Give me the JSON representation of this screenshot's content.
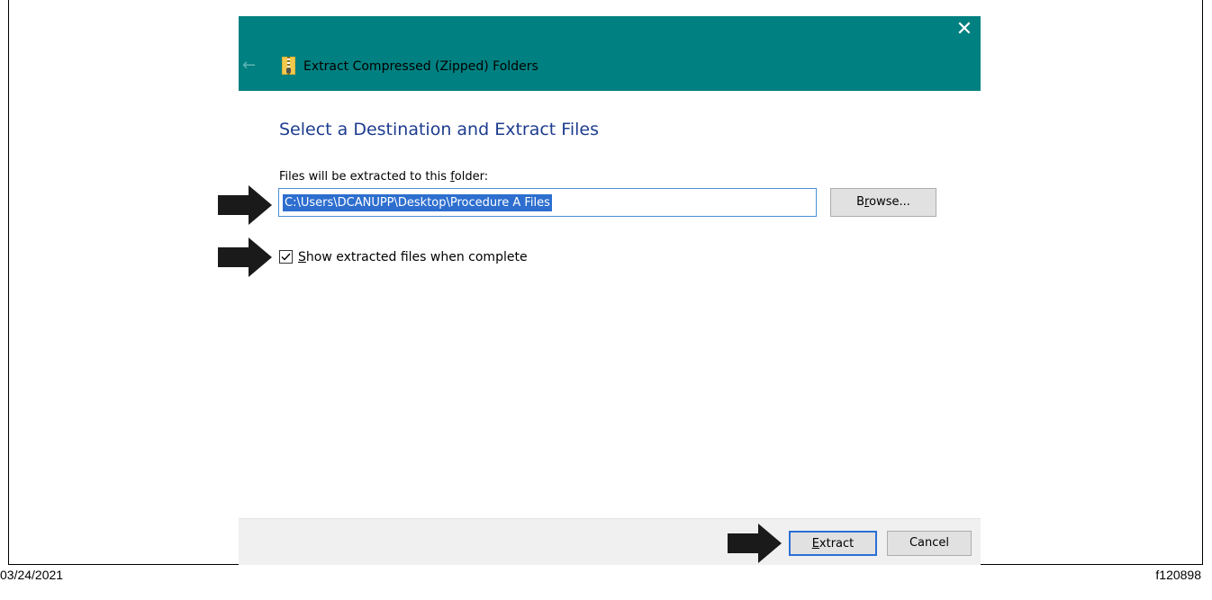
{
  "window": {
    "title": "Extract Compressed (Zipped) Folders",
    "close_glyph": "✕",
    "back_glyph": "←",
    "icon": "zip-folder-icon",
    "titlebar_color": "#008080"
  },
  "main": {
    "heading": "Select a Destination and Extract Files",
    "destination_label": "Files will be extracted to this folder:",
    "destination_value": "C:\\Users\\DCANUPP\\Desktop\\Procedure A Files",
    "browse_label": "Browse...",
    "show_files_checkbox": {
      "label": "Show extracted files when complete",
      "checked": true
    }
  },
  "footer": {
    "extract_label": "Extract",
    "cancel_label": "Cancel"
  },
  "annotations": {
    "date": "03/24/2021",
    "figure_id": "f120898",
    "arrow_icon": "right-pointing-callout-arrow-icon",
    "heading_color": "#1e3d8f",
    "selection_color": "#2d6ecf"
  }
}
